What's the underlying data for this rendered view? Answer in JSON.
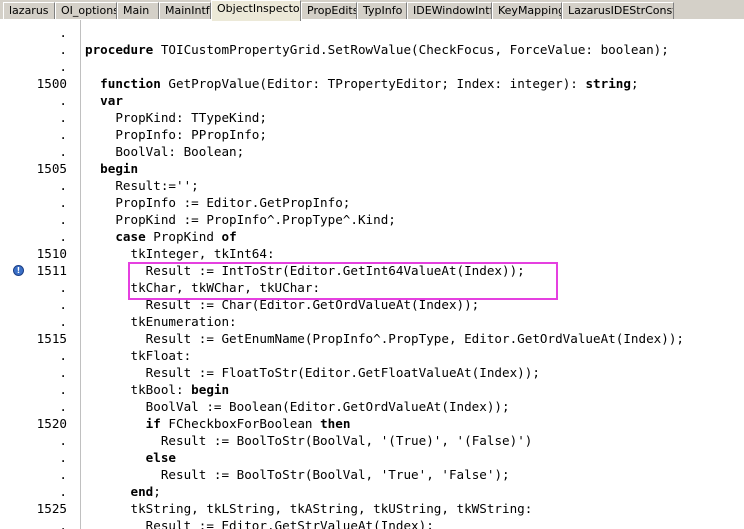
{
  "tabs": [
    {
      "label": "lazarus",
      "active": false
    },
    {
      "label": "OI_options",
      "active": false
    },
    {
      "label": "Main",
      "active": false
    },
    {
      "label": "MainIntf",
      "active": false
    },
    {
      "label": "ObjectInspector",
      "active": true
    },
    {
      "label": "PropEdits",
      "active": false
    },
    {
      "label": "TypInfo",
      "active": false
    },
    {
      "label": "IDEWindowIntf",
      "active": false
    },
    {
      "label": "KeyMapping",
      "active": false
    },
    {
      "label": "LazarusIDEStrConsts",
      "active": false
    }
  ],
  "editor": {
    "breakpoint_line": "1511",
    "highlight_color": "#e540e0",
    "lines": [
      {
        "num": ".",
        "code": ""
      },
      {
        "num": ".",
        "code": "procedure TOICustomPropertyGrid.SetRowValue(CheckFocus, ForceValue: boolean);"
      },
      {
        "num": ".",
        "code": ""
      },
      {
        "num": "1500",
        "code": "  function GetPropValue(Editor: TPropertyEditor; Index: integer): string;"
      },
      {
        "num": ".",
        "code": "  var"
      },
      {
        "num": ".",
        "code": "    PropKind: TTypeKind;"
      },
      {
        "num": ".",
        "code": "    PropInfo: PPropInfo;"
      },
      {
        "num": ".",
        "code": "    BoolVal: Boolean;"
      },
      {
        "num": "1505",
        "code": "  begin"
      },
      {
        "num": ".",
        "code": "    Result:='';"
      },
      {
        "num": ".",
        "code": "    PropInfo := Editor.GetPropInfo;"
      },
      {
        "num": ".",
        "code": "    PropKind := PropInfo^.PropType^.Kind;"
      },
      {
        "num": ".",
        "code": "    case PropKind of"
      },
      {
        "num": "1510",
        "code": "      tkInteger, tkInt64:"
      },
      {
        "num": "1511",
        "code": "        Result := IntToStr(Editor.GetInt64ValueAt(Index));"
      },
      {
        "num": ".",
        "code": "      tkChar, tkWChar, tkUChar:"
      },
      {
        "num": ".",
        "code": "        Result := Char(Editor.GetOrdValueAt(Index));"
      },
      {
        "num": ".",
        "code": "      tkEnumeration:"
      },
      {
        "num": "1515",
        "code": "        Result := GetEnumName(PropInfo^.PropType, Editor.GetOrdValueAt(Index));"
      },
      {
        "num": ".",
        "code": "      tkFloat:"
      },
      {
        "num": ".",
        "code": "        Result := FloatToStr(Editor.GetFloatValueAt(Index));"
      },
      {
        "num": ".",
        "code": "      tkBool: begin"
      },
      {
        "num": ".",
        "code": "        BoolVal := Boolean(Editor.GetOrdValueAt(Index));"
      },
      {
        "num": "1520",
        "code": "        if FCheckboxForBoolean then"
      },
      {
        "num": ".",
        "code": "          Result := BoolToStr(BoolVal, '(True)', '(False)')"
      },
      {
        "num": ".",
        "code": "        else"
      },
      {
        "num": ".",
        "code": "          Result := BoolToStr(BoolVal, 'True', 'False');"
      },
      {
        "num": ".",
        "code": "      end;"
      },
      {
        "num": "1525",
        "code": "      tkString, tkLString, tkAString, tkUString, tkWString:"
      },
      {
        "num": ".",
        "code": "        Result := Editor.GetStrValueAt(Index);"
      }
    ]
  }
}
